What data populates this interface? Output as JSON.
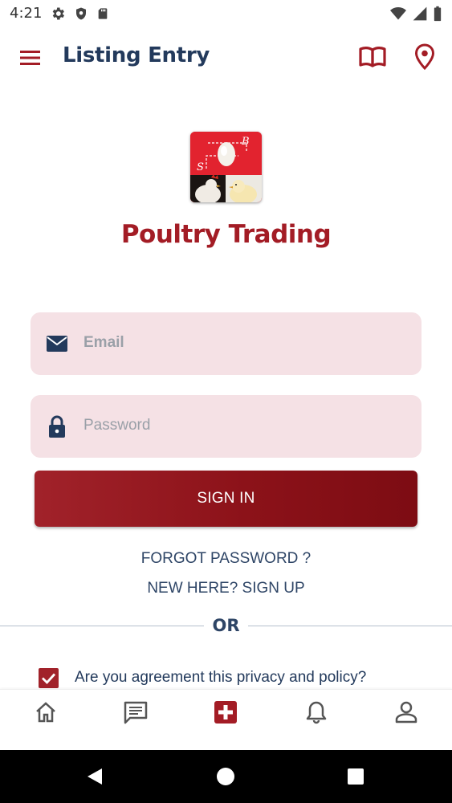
{
  "status_bar": {
    "time": "4:21",
    "left_icons": [
      "settings-icon",
      "shield-icon",
      "sd-card-icon"
    ],
    "right_icons": [
      "wifi-icon",
      "signal-icon",
      "battery-icon"
    ]
  },
  "app_bar": {
    "title": "Listing Entry",
    "menu_icon": "hamburger-menu-icon",
    "actions": [
      "book-icon",
      "location-pin-icon"
    ],
    "accent_color": "#a31c25"
  },
  "brand": {
    "name": "Poultry Trading",
    "logo_letters": [
      "S",
      "B"
    ]
  },
  "form": {
    "email_placeholder": "Email",
    "email_value": "",
    "password_placeholder": "Password",
    "password_value": "",
    "signin_label": "SIGN IN",
    "forgot_label": "FORGOT PASSWORD ?",
    "signup_label": "NEW HERE? SIGN UP",
    "divider_label": "OR",
    "policy_label": "Are you agreement this privacy and policy?",
    "policy_checked": true
  },
  "bottom_nav": {
    "items": [
      "home-icon",
      "messages-icon",
      "add-listing-icon",
      "notifications-icon",
      "profile-icon"
    ],
    "active": "add-listing-icon"
  },
  "colors": {
    "primary": "#a31c25",
    "navy": "#233a5c",
    "field_bg": "#f5e1e5"
  }
}
